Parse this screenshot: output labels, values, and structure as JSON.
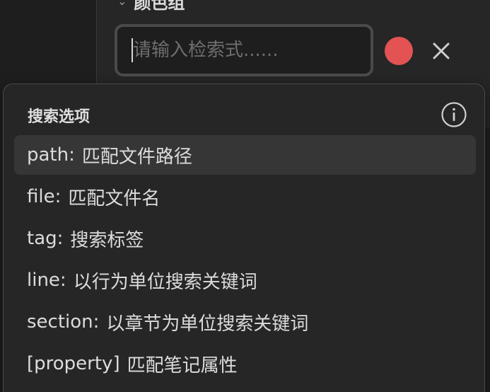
{
  "group": {
    "title": "颜色组",
    "chevron_icon": "chevron-down-icon"
  },
  "search": {
    "placeholder": "请输入检索式......",
    "value": ""
  },
  "color_swatch": {
    "color": "#e35353"
  },
  "dropdown": {
    "title": "搜索选项",
    "info_icon": "info-icon",
    "options": [
      {
        "key": "path:",
        "desc": "匹配文件路径",
        "selected": true
      },
      {
        "key": "file:",
        "desc": "匹配文件名",
        "selected": false
      },
      {
        "key": "tag:",
        "desc": "搜索标签",
        "selected": false
      },
      {
        "key": "line:",
        "desc": "以行为单位搜索关键词",
        "selected": false
      },
      {
        "key": "section:",
        "desc": "以章节为单位搜索关键词",
        "selected": false
      },
      {
        "key": "[property]",
        "desc": "匹配笔记属性",
        "selected": false
      }
    ]
  }
}
